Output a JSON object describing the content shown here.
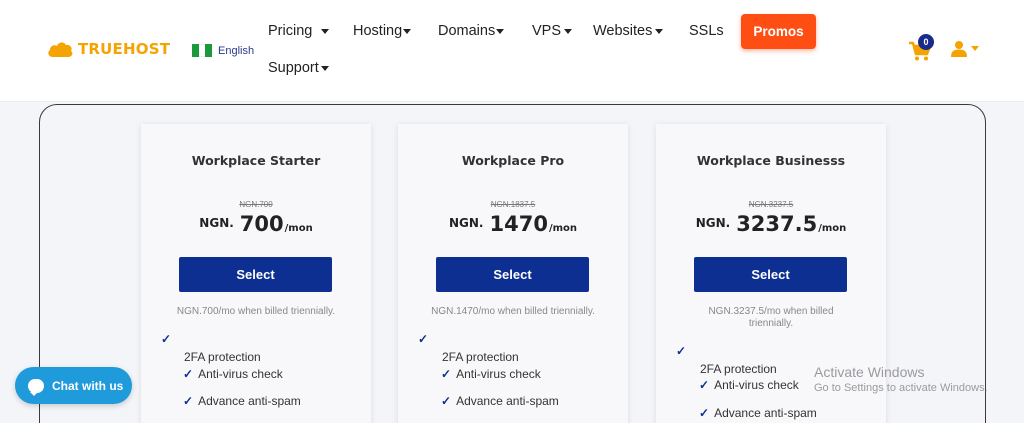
{
  "header": {
    "logo_text": "TRUEHOST",
    "language": "English",
    "nav": [
      {
        "label": "Pricing"
      },
      {
        "label": "Hosting"
      },
      {
        "label": "Domains"
      },
      {
        "label": "VPS"
      },
      {
        "label": "Websites"
      },
      {
        "label": "SSLs"
      },
      {
        "label": "Support"
      }
    ],
    "promos_label": "Promos",
    "cart_count": "0",
    "accent_color": "#f5a300",
    "promo_color": "#ff4e14"
  },
  "plans": [
    {
      "name": "Workplace Starter",
      "old_price": "NGN.700",
      "currency": "NGN.",
      "amount": "700",
      "period": "/mon",
      "button": "Select",
      "billing": "NGN.700/mo when billed triennially.",
      "features": [
        "2FA protection",
        "Anti-virus check",
        "Advance anti-spam"
      ]
    },
    {
      "name": "Workplace Pro",
      "old_price": "NGN.1837.5",
      "currency": "NGN.",
      "amount": "1470",
      "period": "/mon",
      "button": "Select",
      "billing": "NGN.1470/mo when billed triennially.",
      "features": [
        "2FA protection",
        "Anti-virus check",
        "Advance anti-spam"
      ]
    },
    {
      "name": "Workplace Businesss",
      "old_price": "NGN.3237.5",
      "currency": "NGN.",
      "amount": "3237.5",
      "period": "/mon",
      "button": "Select",
      "billing": "NGN.3237.5/mo when billed triennially.",
      "features": [
        "2FA protection",
        "Anti-virus check",
        "Advance anti-spam"
      ]
    }
  ],
  "chat": {
    "label": "Chat with us"
  },
  "watermark": {
    "line1": "Activate Windows",
    "line2": "Go to Settings to activate Windows."
  },
  "brand_button_color": "#0c2f91"
}
